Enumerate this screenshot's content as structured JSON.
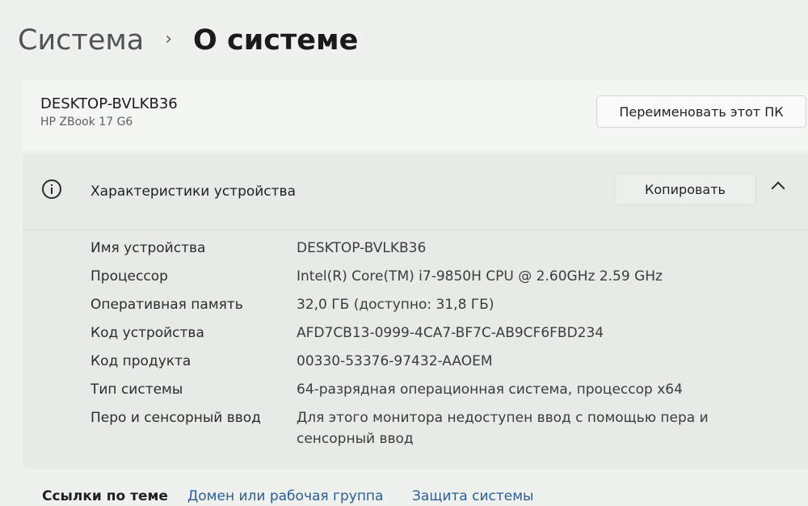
{
  "breadcrumb": {
    "parent": "Система",
    "separator": "›",
    "current": "О системе"
  },
  "device": {
    "name": "DESKTOP-BVLKB36",
    "model": "HP ZBook 17 G6",
    "rename_label": "Переименовать этот ПК"
  },
  "specs": {
    "title": "Характеристики устройства",
    "copy_label": "Копировать",
    "rows": [
      {
        "label": "Имя устройства",
        "value": "DESKTOP-BVLKB36"
      },
      {
        "label": "Процессор",
        "value": "Intel(R) Core(TM) i7-9850H CPU @ 2.60GHz   2.59 GHz"
      },
      {
        "label": "Оперативная память",
        "value": "32,0 ГБ (доступно: 31,8 ГБ)"
      },
      {
        "label": "Код устройства",
        "value": "AFD7CB13-0999-4CA7-BF7C-AB9CF6FBD234"
      },
      {
        "label": "Код продукта",
        "value": "00330-53376-97432-AAOEM"
      },
      {
        "label": "Тип системы",
        "value": "64-разрядная операционная система, процессор x64"
      },
      {
        "label": "Перо и сенсорный ввод",
        "value": "Для этого монитора недоступен ввод с помощью пера и сенсорный ввод"
      }
    ]
  },
  "related": {
    "heading": "Ссылки по теме",
    "links": [
      "Домен или рабочая группа",
      "Защита системы"
    ]
  },
  "icons": {
    "info": "info-icon",
    "collapse": "chevron-up-icon"
  },
  "colors": {
    "link": "#2a5d99",
    "background": "#eff1ef"
  }
}
